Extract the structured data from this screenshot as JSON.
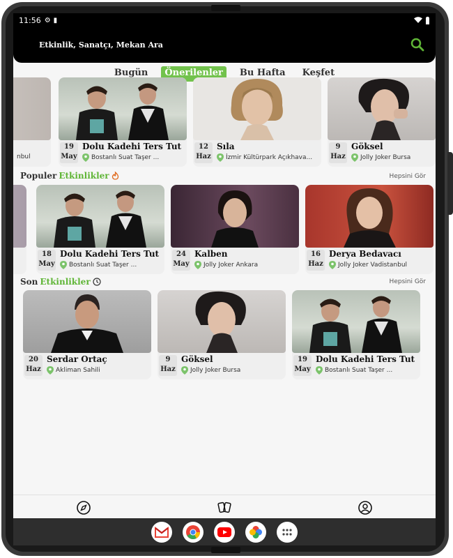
{
  "status": {
    "time": "11:56"
  },
  "search": {
    "placeholder": "Etkinlik, Sanatçı, Mekan Ara"
  },
  "tabs": [
    {
      "label": "Bugün",
      "active": false
    },
    {
      "label": "Önerilenler",
      "active": true
    },
    {
      "label": "Bu Hafta",
      "active": false
    },
    {
      "label": "Keşfet",
      "active": false
    }
  ],
  "recommended": {
    "partial_venue": "nbul",
    "cards": [
      {
        "day": "19",
        "month": "May",
        "title": "Dolu Kadehi Ters Tut",
        "venue": "Bostanlı Suat Taşer ..."
      },
      {
        "day": "12",
        "month": "Haz",
        "title": "Sıla",
        "venue": "İzmir Kültürpark Açıkhava..."
      },
      {
        "day": "9",
        "month": "Haz",
        "title": "Göksel",
        "venue": "Jolly Joker Bursa"
      }
    ]
  },
  "popular": {
    "title_prefix": "Populer",
    "title_accent": "Etkinlikler",
    "see_all": "Hepsini Gör",
    "cards": [
      {
        "day": "18",
        "month": "May",
        "title": "Dolu Kadehi Ters Tut",
        "venue": "Bostanlı Suat Taşer ..."
      },
      {
        "day": "24",
        "month": "May",
        "title": "Kalben",
        "venue": "Jolly Joker Ankara"
      },
      {
        "day": "16",
        "month": "Haz",
        "title": "Derya Bedavacı",
        "venue": "Jolly Joker Vadistanbul"
      }
    ]
  },
  "recent": {
    "title_prefix": "Son",
    "title_accent": "Etkinlikler",
    "see_all": "Hepsini Gör",
    "cards": [
      {
        "day": "20",
        "month": "Haz",
        "title": "Serdar Ortaç",
        "venue": "Akliman Sahili"
      },
      {
        "day": "9",
        "month": "Haz",
        "title": "Göksel",
        "venue": "Jolly Joker Bursa"
      },
      {
        "day": "19",
        "month": "May",
        "title": "Dolu Kadehi Ters Tut",
        "venue": "Bostanlı Suat Taşer ..."
      }
    ]
  },
  "colors": {
    "accent": "#72c24c",
    "pin": "#7cc36b",
    "flame": "#e06a1e"
  },
  "nav_icons": [
    "compass-icon",
    "cards-icon",
    "profile-icon"
  ],
  "dock_apps": [
    "gmail-icon",
    "chrome-icon",
    "youtube-icon",
    "photos-icon",
    "app-drawer-icon"
  ]
}
